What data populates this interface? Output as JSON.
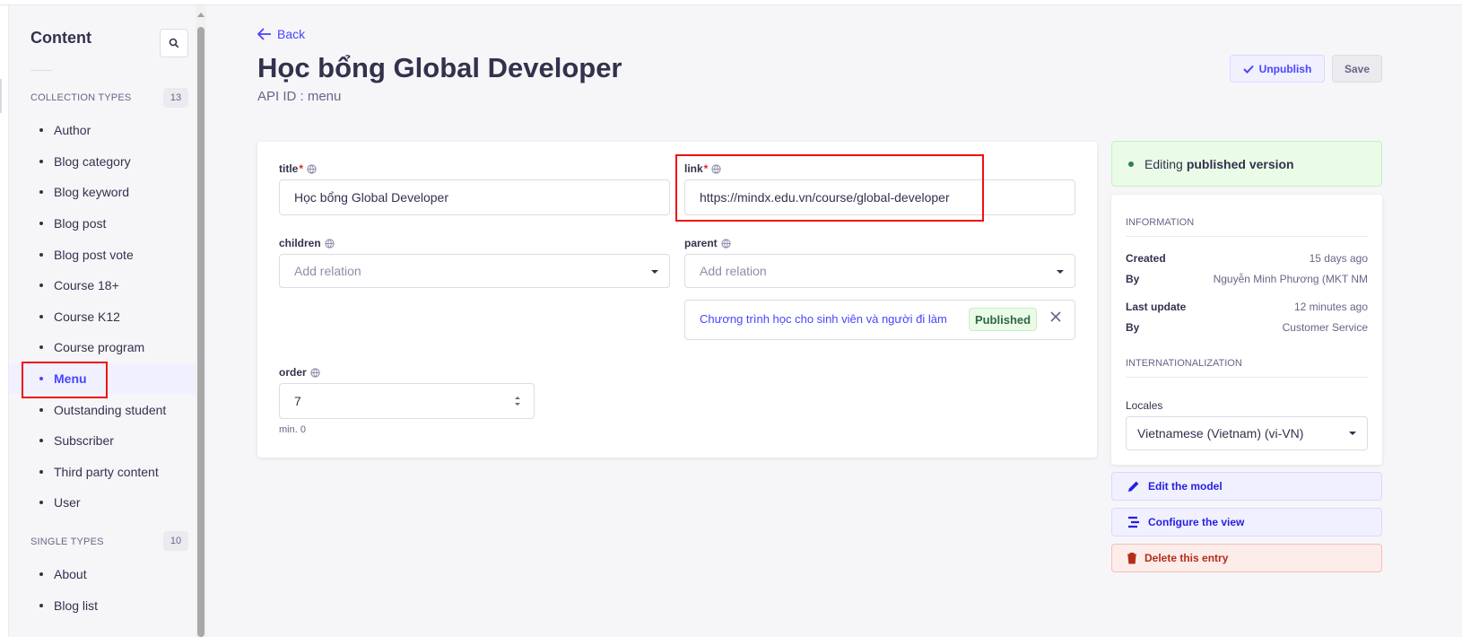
{
  "sidebar": {
    "title": "Content",
    "collection_types": {
      "label": "COLLECTION TYPES",
      "count": "13",
      "items": [
        "Author",
        "Blog category",
        "Blog keyword",
        "Blog post",
        "Blog post vote",
        "Course 18+",
        "Course K12",
        "Course program",
        "Menu",
        "Outstanding student",
        "Subscriber",
        "Third party content",
        "User"
      ],
      "active": "Menu"
    },
    "single_types": {
      "label": "SINGLE TYPES",
      "count": "10",
      "items": [
        "About",
        "Blog list"
      ]
    }
  },
  "header": {
    "back_label": "Back",
    "title": "Học bổng Global Developer",
    "api_id": "API ID : menu",
    "unpublish_label": "Unpublish",
    "save_label": "Save"
  },
  "form": {
    "title_label": "title",
    "title_value": "Học bổng Global Developer",
    "link_label": "link",
    "link_value": "https://mindx.edu.vn/course/global-developer",
    "children_label": "children",
    "children_placeholder": "Add relation",
    "parent_label": "parent",
    "parent_placeholder": "Add relation",
    "parent_relation": "Chương trình học cho sinh viên và người đi làm",
    "parent_status": "Published",
    "order_label": "order",
    "order_value": "7",
    "order_hint": "min. 0",
    "required_mark": "*"
  },
  "panel": {
    "editing_prefix": "Editing",
    "editing_version": "published version",
    "information_heading": "INFORMATION",
    "created_label": "Created",
    "created_value": "15 days ago",
    "by_label": "By",
    "created_by": "Nguyễn Minh Phương (MKT NM",
    "last_update_label": "Last update",
    "last_update_value": "12 minutes ago",
    "updated_by": "Customer Service",
    "i18n_heading": "INTERNATIONALIZATION",
    "locales_label": "Locales",
    "locale_value": "Vietnamese (Vietnam) (vi-VN)",
    "edit_model": "Edit the model",
    "configure_view": "Configure the view",
    "delete_entry": "Delete this entry"
  },
  "colors": {
    "primary": "#4945ff",
    "success": "#328048",
    "danger": "#d02b20",
    "highlight_box": "#ee1111"
  },
  "icons": [
    "search-icon",
    "arrow-left-icon",
    "check-icon",
    "globe-icon",
    "close-icon",
    "pencil-icon",
    "layout-icon",
    "trash-icon",
    "chevron-down-icon",
    "stepper-icon"
  ]
}
